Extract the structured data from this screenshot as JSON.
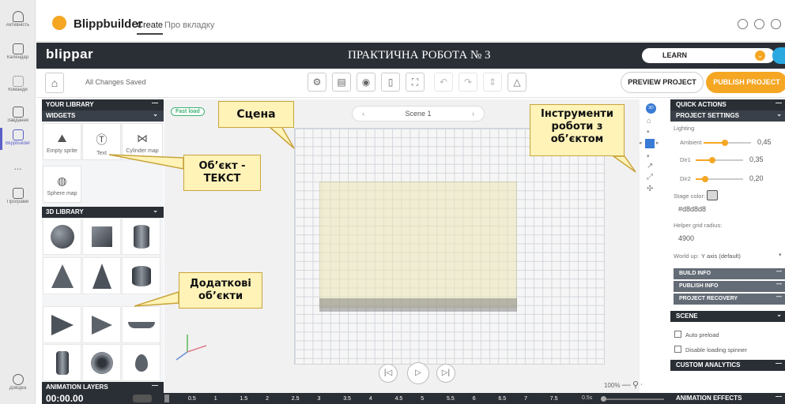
{
  "rail": {
    "items": [
      {
        "icon": "bell-icon",
        "label": "Активність"
      },
      {
        "icon": "calendar-icon",
        "label": "Календар"
      },
      {
        "icon": "teams-icon",
        "label": "Команди"
      },
      {
        "icon": "assignment-icon",
        "label": "Завдання"
      },
      {
        "icon": "blippbuilder-icon",
        "label": "Blippbuilder"
      },
      {
        "icon": "more-icon",
        "label": "..."
      },
      {
        "icon": "apps-icon",
        "label": "Програми"
      },
      {
        "icon": "help-icon",
        "label": "Довідка"
      }
    ]
  },
  "header": {
    "app_name": "Blippbuilder",
    "tab_create": "Create",
    "tab_about": "Про вкладку"
  },
  "darkbar": {
    "brand": "blippar",
    "project_title": "ПРАКТИЧНА РОБОТА № 3",
    "mode": "LEARN"
  },
  "toolbar": {
    "saved_status": "All Changes Saved",
    "preview": "PREVIEW PROJECT",
    "publish": "PUBLISH PROJECT"
  },
  "library": {
    "your_library": "YOUR LIBRARY",
    "widgets": "WIDGETS",
    "widget_items": [
      {
        "icon": "image-icon",
        "label": "Empty sprite"
      },
      {
        "icon": "text-icon",
        "label": "Text"
      },
      {
        "icon": "cylinder-map-icon",
        "label": "Cylinder map"
      },
      {
        "icon": "sphere-map-icon",
        "label": "Sphere map"
      }
    ],
    "library_3d": "3D LIBRARY",
    "animation_layers": "ANIMATION LAYERS"
  },
  "scene": {
    "fast_load": "Fast load",
    "scene_name": "Scene 1",
    "zoom": "100%"
  },
  "right_panel": {
    "quick_actions": "QUICK ACTIONS",
    "project_settings": "PROJECT SETTINGS",
    "lighting": "Lighting",
    "ambient_label": "Ambient",
    "ambient": "0,45",
    "dir1_label": "Dir1",
    "dir1": "0,35",
    "dir2_label": "Dir2",
    "dir2": "0,20",
    "stage_color_label": "Stage color:",
    "stage_color": "#d8d8d8",
    "grid_radius_label": "Helper grid radius:",
    "grid_radius": "4900",
    "world_up_label": "World up:",
    "world_up": "Y axis (default)",
    "build_info": "BUILD INFO",
    "publish_info": "PUBLISH INFO",
    "project_recovery": "PROJECT RECOVERY",
    "scene": "SCENE",
    "auto_preload": "Auto preload",
    "disable_spinner": "Disable loading spinner",
    "custom_analytics": "CUSTOM ANALYTICS",
    "animation_effects": "ANIMATION EFFECTS"
  },
  "timeline": {
    "time": "00:00.00",
    "ticks": [
      "0.5",
      "1",
      "1.5",
      "2",
      "2.5",
      "3",
      "3.5",
      "4",
      "4.5",
      "5",
      "5.5",
      "6",
      "6.5",
      "7",
      "7.5"
    ],
    "speed": "0.5s"
  },
  "callouts": {
    "scene": "Сцена",
    "text_object": "Об’єкт -\nТЕКСТ",
    "extra_objects": "Додаткові\nоб’єкти",
    "tools": "Інструменти\nроботи з\nоб’єктом"
  },
  "colors": {
    "accent": "#f5a623",
    "dark": "#2a2f36",
    "teams": "#5b5fc7"
  }
}
